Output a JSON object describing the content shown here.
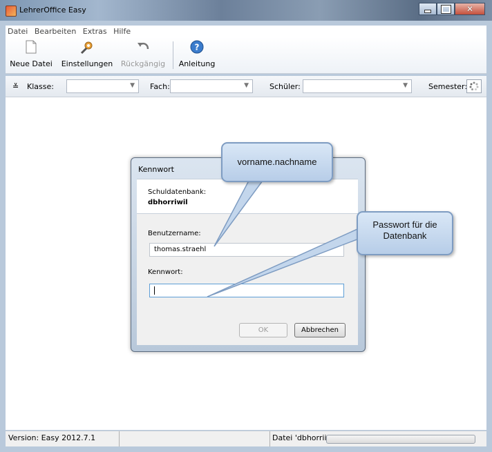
{
  "window": {
    "title": "LehrerOffice Easy"
  },
  "menu": [
    "Datei",
    "Bearbeiten",
    "Extras",
    "Hilfe"
  ],
  "toolbar": {
    "new_file": "Neue Datei",
    "settings": "Einstellungen",
    "undo": "Rückgängig",
    "guide": "Anleitung"
  },
  "filters": {
    "klasse": "Klasse:",
    "fach": "Fach:",
    "schueler": "Schüler:",
    "semester": "Semester:"
  },
  "status": {
    "version": "Version: Easy 2012.7.1",
    "file": "Datei 'dbhorrii"
  },
  "dialog": {
    "title": "Kennwort",
    "db_label": "Schuldatenbank:",
    "db_value": "dbhorriwil",
    "user_label": "Benutzername:",
    "user_value": "thomas.straehl",
    "pass_label": "Kennwort:",
    "pass_value": "",
    "ok": "OK",
    "cancel": "Abbrechen"
  },
  "callouts": {
    "user": "vorname.nachname",
    "password": "Passwort für die Datenbank"
  }
}
